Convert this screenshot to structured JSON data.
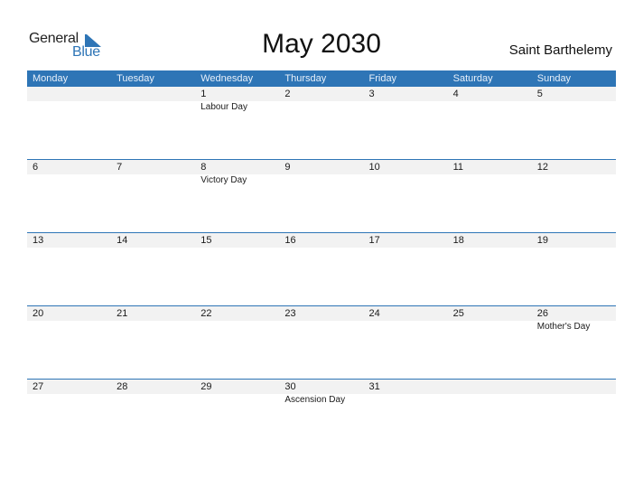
{
  "logo": {
    "line1": "General",
    "line2": "Blue"
  },
  "title": "May 2030",
  "country": "Saint Barthelemy",
  "colors": {
    "accent": "#2e75b6",
    "date_strip": "#f2f2f2"
  },
  "weekdays": [
    "Monday",
    "Tuesday",
    "Wednesday",
    "Thursday",
    "Friday",
    "Saturday",
    "Sunday"
  ],
  "weeks": [
    [
      {
        "day": "",
        "holiday": ""
      },
      {
        "day": "",
        "holiday": ""
      },
      {
        "day": "1",
        "holiday": "Labour Day"
      },
      {
        "day": "2",
        "holiday": ""
      },
      {
        "day": "3",
        "holiday": ""
      },
      {
        "day": "4",
        "holiday": ""
      },
      {
        "day": "5",
        "holiday": ""
      }
    ],
    [
      {
        "day": "6",
        "holiday": ""
      },
      {
        "day": "7",
        "holiday": ""
      },
      {
        "day": "8",
        "holiday": "Victory Day"
      },
      {
        "day": "9",
        "holiday": ""
      },
      {
        "day": "10",
        "holiday": ""
      },
      {
        "day": "11",
        "holiday": ""
      },
      {
        "day": "12",
        "holiday": ""
      }
    ],
    [
      {
        "day": "13",
        "holiday": ""
      },
      {
        "day": "14",
        "holiday": ""
      },
      {
        "day": "15",
        "holiday": ""
      },
      {
        "day": "16",
        "holiday": ""
      },
      {
        "day": "17",
        "holiday": ""
      },
      {
        "day": "18",
        "holiday": ""
      },
      {
        "day": "19",
        "holiday": ""
      }
    ],
    [
      {
        "day": "20",
        "holiday": ""
      },
      {
        "day": "21",
        "holiday": ""
      },
      {
        "day": "22",
        "holiday": ""
      },
      {
        "day": "23",
        "holiday": ""
      },
      {
        "day": "24",
        "holiday": ""
      },
      {
        "day": "25",
        "holiday": ""
      },
      {
        "day": "26",
        "holiday": "Mother's Day"
      }
    ],
    [
      {
        "day": "27",
        "holiday": ""
      },
      {
        "day": "28",
        "holiday": ""
      },
      {
        "day": "29",
        "holiday": ""
      },
      {
        "day": "30",
        "holiday": "Ascension Day"
      },
      {
        "day": "31",
        "holiday": ""
      },
      {
        "day": "",
        "holiday": ""
      },
      {
        "day": "",
        "holiday": ""
      }
    ]
  ]
}
